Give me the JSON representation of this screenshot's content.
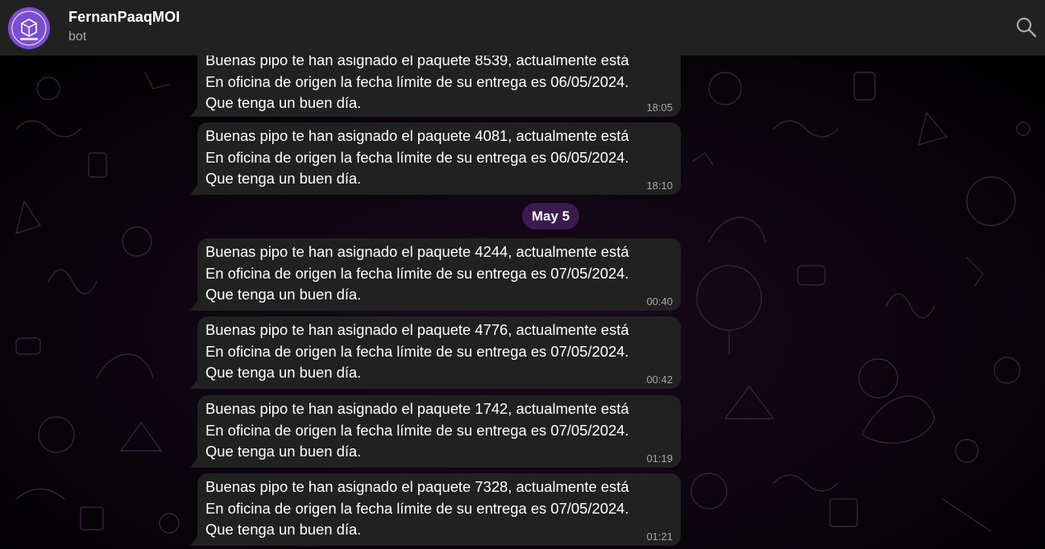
{
  "header": {
    "title": "FernanPaaqMOI",
    "subtitle": "bot",
    "avatar_icon": "package-robot-icon",
    "avatar_color": "#7c4ecf",
    "search_icon": "search-icon"
  },
  "date_separator": "May 5",
  "messages": [
    {
      "line1": "Buenas pipo te han asignado el paquete 8539, actualmente está",
      "line2": "En oficina de origen la fecha límite de su entrega es 06/05/2024.",
      "line3": "Que tenga un buen día.",
      "time": "18:05"
    },
    {
      "line1": "Buenas pipo te han asignado el paquete 4081, actualmente está",
      "line2": "En oficina de origen la fecha límite de su entrega es 06/05/2024.",
      "line3": "Que tenga un buen día.",
      "time": "18:10"
    },
    {
      "line1": "Buenas pipo te han asignado el paquete 4244, actualmente está",
      "line2": "En oficina de origen la fecha límite de su entrega es 07/05/2024.",
      "line3": "Que tenga un buen día.",
      "time": "00:40"
    },
    {
      "line1": "Buenas pipo te han asignado el paquete 4776, actualmente está",
      "line2": "En oficina de origen la fecha límite de su entrega es 07/05/2024.",
      "line3": "Que tenga un buen día.",
      "time": "00:42"
    },
    {
      "line1": "Buenas pipo te han asignado el paquete 1742, actualmente está",
      "line2": "En oficina de origen la fecha límite de su entrega es 07/05/2024.",
      "line3": "Que tenga un buen día.",
      "time": "01:19"
    },
    {
      "line1": "Buenas pipo te han asignado el paquete 7328, actualmente está",
      "line2": "En oficina de origen la fecha límite de su entrega es 07/05/2024.",
      "line3": "Que tenga un buen día.",
      "time": "01:21"
    }
  ],
  "colors": {
    "bubble": "#212121",
    "header": "#212121",
    "date_pill": "#3b1a4e",
    "accent": "#7c4ecf"
  }
}
